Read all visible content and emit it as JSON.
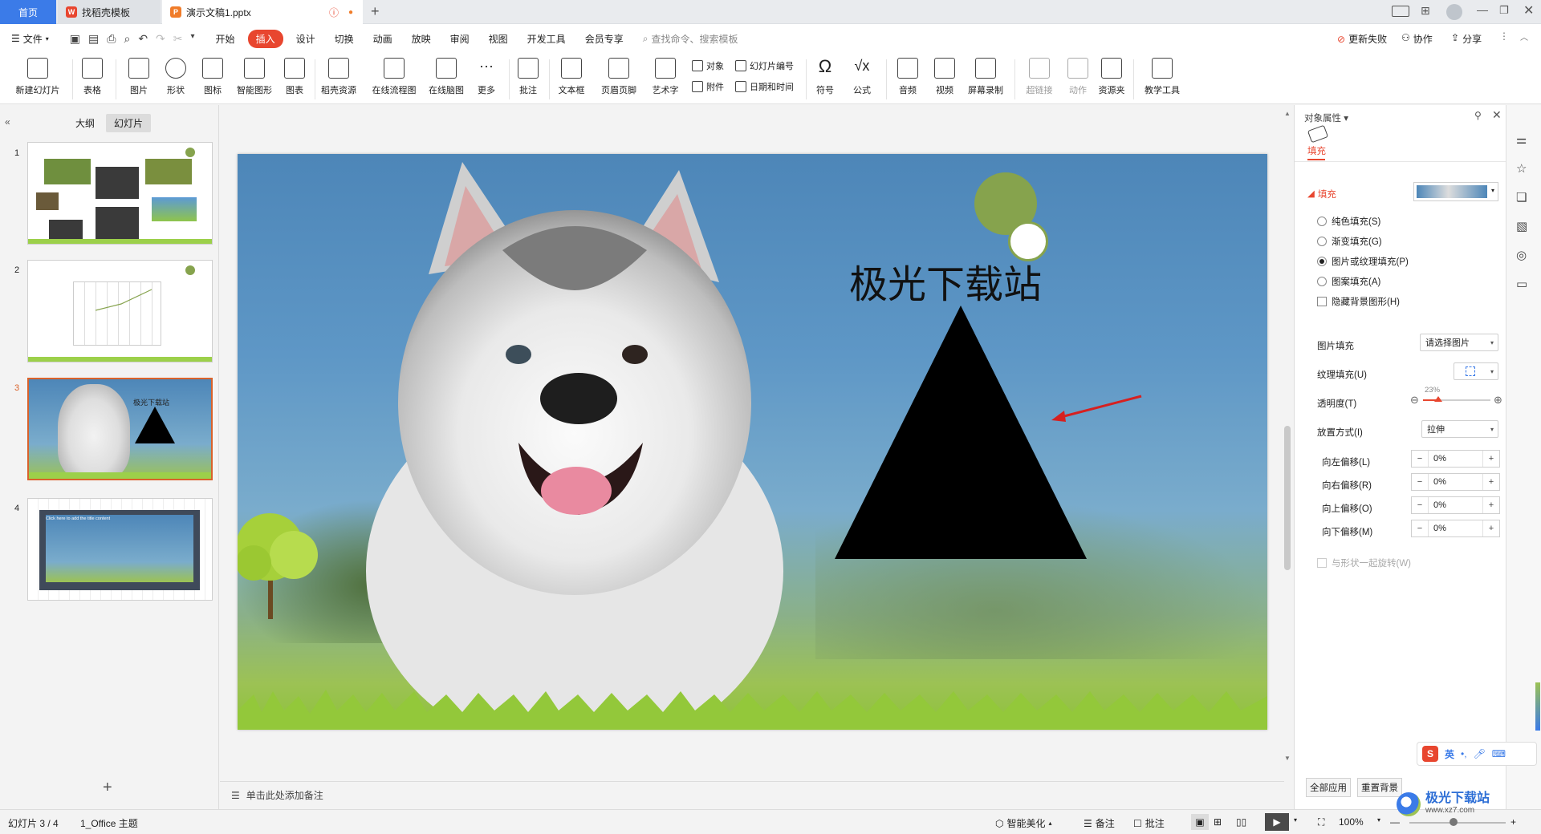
{
  "tabs": {
    "home": "首页",
    "template": "找稻壳模板",
    "document": "演示文稿1.pptx"
  },
  "menu": {
    "file": "文件",
    "items": [
      "开始",
      "插入",
      "设计",
      "切换",
      "动画",
      "放映",
      "审阅",
      "视图",
      "开发工具",
      "会员专享"
    ],
    "search_placeholder": "查找命令、搜索模板",
    "update_failed": "更新失败",
    "collaborate": "协作",
    "share": "分享"
  },
  "ribbon": {
    "new_slide": "新建幻灯片",
    "table": "表格",
    "picture": "图片",
    "shape": "形状",
    "icon": "图标",
    "smart_art": "智能图形",
    "chart": "图表",
    "docer_res": "稻壳资源",
    "flowchart": "在线流程图",
    "mindmap": "在线脑图",
    "more": "更多",
    "comment": "批注",
    "textbox": "文本框",
    "header_footer": "页眉页脚",
    "word_art": "艺术字",
    "object": "对象",
    "slide_number": "幻灯片编号",
    "attachment": "附件",
    "datetime": "日期和时间",
    "symbol": "符号",
    "formula": "公式",
    "audio": "音频",
    "video": "视频",
    "screen_record": "屏幕录制",
    "hyperlink": "超链接",
    "action": "动作",
    "resource": "资源夹",
    "teaching": "教学工具"
  },
  "left_panel": {
    "outline_tab": "大纲",
    "slides_tab": "幻灯片",
    "slide_numbers": [
      "1",
      "2",
      "3",
      "4"
    ],
    "thumb3_title": "极光下载站",
    "thumb4_text": "Click here to add the title content"
  },
  "slide": {
    "title": "极光下载站",
    "notes_placeholder": "单击此处添加备注"
  },
  "props": {
    "panel_title": "对象属性",
    "fill_tab": "填充",
    "fill_section": "填充",
    "solid_fill": "纯色填充(S)",
    "gradient_fill": "渐变填充(G)",
    "picture_fill": "图片或纹理填充(P)",
    "pattern_fill": "图案填充(A)",
    "hide_bg": "隐藏背景图形(H)",
    "picture_fill_label": "图片填充",
    "picture_fill_value": "请选择图片",
    "texture_fill_label": "纹理填充(U)",
    "transparency_label": "透明度(T)",
    "transparency_value": "23%",
    "transparency_fraction": 0.23,
    "placement_label": "放置方式(I)",
    "placement_value": "拉伸",
    "offset_left_label": "向左偏移(L)",
    "offset_left": "0%",
    "offset_right_label": "向右偏移(R)",
    "offset_right": "0%",
    "offset_top_label": "向上偏移(O)",
    "offset_top": "0%",
    "offset_bottom_label": "向下偏移(M)",
    "offset_bottom": "0%",
    "rotate_with_shape": "与形状一起旋转(W)",
    "apply_all": "全部应用",
    "reset_bg": "重置背景"
  },
  "statusbar": {
    "slide_pos": "幻灯片 3 / 4",
    "theme": "1_Office 主题",
    "smart_beautify": "智能美化",
    "notes": "备注",
    "comments": "批注",
    "zoom": "100%"
  },
  "ime": {
    "lang": "英"
  },
  "watermark": {
    "text": "极光下载站",
    "url": "www.xz7.com"
  },
  "colors": {
    "accent": "#3b7be8",
    "insert_tab": "#e8462f",
    "selected_thumb": "#d9622b",
    "triangle": "#000000",
    "green_circle": "#86a34d",
    "arrow": "#d62020"
  }
}
